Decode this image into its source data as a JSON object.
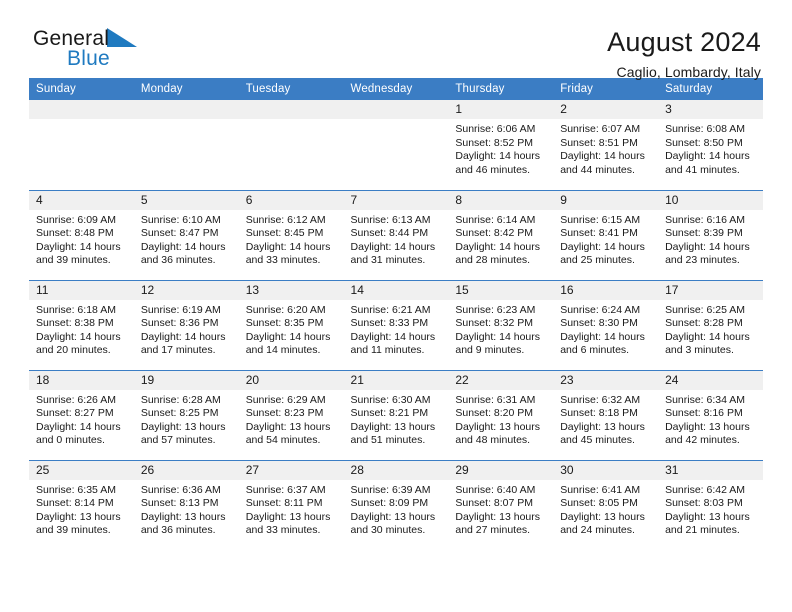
{
  "brand": {
    "word1": "General",
    "word2": "Blue",
    "logo_icon": "triangle-flag-icon",
    "accent_color": "#1f7ac0"
  },
  "header": {
    "title": "August 2024",
    "subtitle": "Caglio, Lombardy, Italy"
  },
  "theme": {
    "header_blue": "#3b7dc4",
    "daynum_gray": "#f0f0f0",
    "text": "#1a1a1a"
  },
  "weekday_headers": [
    "Sunday",
    "Monday",
    "Tuesday",
    "Wednesday",
    "Thursday",
    "Friday",
    "Saturday"
  ],
  "weeks": [
    [
      {
        "day": "",
        "empty": true,
        "sunrise": "",
        "sunset": "",
        "daylight_line1": "",
        "daylight_line2": ""
      },
      {
        "day": "",
        "empty": true,
        "sunrise": "",
        "sunset": "",
        "daylight_line1": "",
        "daylight_line2": ""
      },
      {
        "day": "",
        "empty": true,
        "sunrise": "",
        "sunset": "",
        "daylight_line1": "",
        "daylight_line2": ""
      },
      {
        "day": "",
        "empty": true,
        "sunrise": "",
        "sunset": "",
        "daylight_line1": "",
        "daylight_line2": ""
      },
      {
        "day": "1",
        "sunrise": "Sunrise: 6:06 AM",
        "sunset": "Sunset: 8:52 PM",
        "daylight_line1": "Daylight: 14 hours",
        "daylight_line2": "and 46 minutes."
      },
      {
        "day": "2",
        "sunrise": "Sunrise: 6:07 AM",
        "sunset": "Sunset: 8:51 PM",
        "daylight_line1": "Daylight: 14 hours",
        "daylight_line2": "and 44 minutes."
      },
      {
        "day": "3",
        "sunrise": "Sunrise: 6:08 AM",
        "sunset": "Sunset: 8:50 PM",
        "daylight_line1": "Daylight: 14 hours",
        "daylight_line2": "and 41 minutes."
      }
    ],
    [
      {
        "day": "4",
        "sunrise": "Sunrise: 6:09 AM",
        "sunset": "Sunset: 8:48 PM",
        "daylight_line1": "Daylight: 14 hours",
        "daylight_line2": "and 39 minutes."
      },
      {
        "day": "5",
        "sunrise": "Sunrise: 6:10 AM",
        "sunset": "Sunset: 8:47 PM",
        "daylight_line1": "Daylight: 14 hours",
        "daylight_line2": "and 36 minutes."
      },
      {
        "day": "6",
        "sunrise": "Sunrise: 6:12 AM",
        "sunset": "Sunset: 8:45 PM",
        "daylight_line1": "Daylight: 14 hours",
        "daylight_line2": "and 33 minutes."
      },
      {
        "day": "7",
        "sunrise": "Sunrise: 6:13 AM",
        "sunset": "Sunset: 8:44 PM",
        "daylight_line1": "Daylight: 14 hours",
        "daylight_line2": "and 31 minutes."
      },
      {
        "day": "8",
        "sunrise": "Sunrise: 6:14 AM",
        "sunset": "Sunset: 8:42 PM",
        "daylight_line1": "Daylight: 14 hours",
        "daylight_line2": "and 28 minutes."
      },
      {
        "day": "9",
        "sunrise": "Sunrise: 6:15 AM",
        "sunset": "Sunset: 8:41 PM",
        "daylight_line1": "Daylight: 14 hours",
        "daylight_line2": "and 25 minutes."
      },
      {
        "day": "10",
        "sunrise": "Sunrise: 6:16 AM",
        "sunset": "Sunset: 8:39 PM",
        "daylight_line1": "Daylight: 14 hours",
        "daylight_line2": "and 23 minutes."
      }
    ],
    [
      {
        "day": "11",
        "sunrise": "Sunrise: 6:18 AM",
        "sunset": "Sunset: 8:38 PM",
        "daylight_line1": "Daylight: 14 hours",
        "daylight_line2": "and 20 minutes."
      },
      {
        "day": "12",
        "sunrise": "Sunrise: 6:19 AM",
        "sunset": "Sunset: 8:36 PM",
        "daylight_line1": "Daylight: 14 hours",
        "daylight_line2": "and 17 minutes."
      },
      {
        "day": "13",
        "sunrise": "Sunrise: 6:20 AM",
        "sunset": "Sunset: 8:35 PM",
        "daylight_line1": "Daylight: 14 hours",
        "daylight_line2": "and 14 minutes."
      },
      {
        "day": "14",
        "sunrise": "Sunrise: 6:21 AM",
        "sunset": "Sunset: 8:33 PM",
        "daylight_line1": "Daylight: 14 hours",
        "daylight_line2": "and 11 minutes."
      },
      {
        "day": "15",
        "sunrise": "Sunrise: 6:23 AM",
        "sunset": "Sunset: 8:32 PM",
        "daylight_line1": "Daylight: 14 hours",
        "daylight_line2": "and 9 minutes."
      },
      {
        "day": "16",
        "sunrise": "Sunrise: 6:24 AM",
        "sunset": "Sunset: 8:30 PM",
        "daylight_line1": "Daylight: 14 hours",
        "daylight_line2": "and 6 minutes."
      },
      {
        "day": "17",
        "sunrise": "Sunrise: 6:25 AM",
        "sunset": "Sunset: 8:28 PM",
        "daylight_line1": "Daylight: 14 hours",
        "daylight_line2": "and 3 minutes."
      }
    ],
    [
      {
        "day": "18",
        "sunrise": "Sunrise: 6:26 AM",
        "sunset": "Sunset: 8:27 PM",
        "daylight_line1": "Daylight: 14 hours",
        "daylight_line2": "and 0 minutes."
      },
      {
        "day": "19",
        "sunrise": "Sunrise: 6:28 AM",
        "sunset": "Sunset: 8:25 PM",
        "daylight_line1": "Daylight: 13 hours",
        "daylight_line2": "and 57 minutes."
      },
      {
        "day": "20",
        "sunrise": "Sunrise: 6:29 AM",
        "sunset": "Sunset: 8:23 PM",
        "daylight_line1": "Daylight: 13 hours",
        "daylight_line2": "and 54 minutes."
      },
      {
        "day": "21",
        "sunrise": "Sunrise: 6:30 AM",
        "sunset": "Sunset: 8:21 PM",
        "daylight_line1": "Daylight: 13 hours",
        "daylight_line2": "and 51 minutes."
      },
      {
        "day": "22",
        "sunrise": "Sunrise: 6:31 AM",
        "sunset": "Sunset: 8:20 PM",
        "daylight_line1": "Daylight: 13 hours",
        "daylight_line2": "and 48 minutes."
      },
      {
        "day": "23",
        "sunrise": "Sunrise: 6:32 AM",
        "sunset": "Sunset: 8:18 PM",
        "daylight_line1": "Daylight: 13 hours",
        "daylight_line2": "and 45 minutes."
      },
      {
        "day": "24",
        "sunrise": "Sunrise: 6:34 AM",
        "sunset": "Sunset: 8:16 PM",
        "daylight_line1": "Daylight: 13 hours",
        "daylight_line2": "and 42 minutes."
      }
    ],
    [
      {
        "day": "25",
        "sunrise": "Sunrise: 6:35 AM",
        "sunset": "Sunset: 8:14 PM",
        "daylight_line1": "Daylight: 13 hours",
        "daylight_line2": "and 39 minutes."
      },
      {
        "day": "26",
        "sunrise": "Sunrise: 6:36 AM",
        "sunset": "Sunset: 8:13 PM",
        "daylight_line1": "Daylight: 13 hours",
        "daylight_line2": "and 36 minutes."
      },
      {
        "day": "27",
        "sunrise": "Sunrise: 6:37 AM",
        "sunset": "Sunset: 8:11 PM",
        "daylight_line1": "Daylight: 13 hours",
        "daylight_line2": "and 33 minutes."
      },
      {
        "day": "28",
        "sunrise": "Sunrise: 6:39 AM",
        "sunset": "Sunset: 8:09 PM",
        "daylight_line1": "Daylight: 13 hours",
        "daylight_line2": "and 30 minutes."
      },
      {
        "day": "29",
        "sunrise": "Sunrise: 6:40 AM",
        "sunset": "Sunset: 8:07 PM",
        "daylight_line1": "Daylight: 13 hours",
        "daylight_line2": "and 27 minutes."
      },
      {
        "day": "30",
        "sunrise": "Sunrise: 6:41 AM",
        "sunset": "Sunset: 8:05 PM",
        "daylight_line1": "Daylight: 13 hours",
        "daylight_line2": "and 24 minutes."
      },
      {
        "day": "31",
        "sunrise": "Sunrise: 6:42 AM",
        "sunset": "Sunset: 8:03 PM",
        "daylight_line1": "Daylight: 13 hours",
        "daylight_line2": "and 21 minutes."
      }
    ]
  ]
}
